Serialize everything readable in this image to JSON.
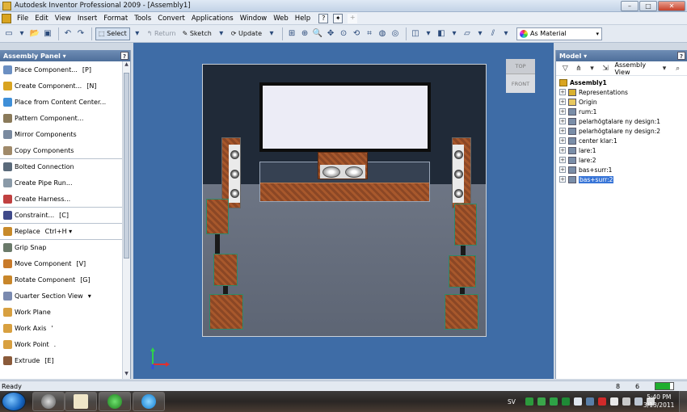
{
  "window": {
    "title": "Autodesk Inventor Professional 2009 - [Assembly1]",
    "minimize": "–",
    "maximize": "□",
    "close": "✕"
  },
  "menu": [
    "File",
    "Edit",
    "View",
    "Insert",
    "Format",
    "Tools",
    "Convert",
    "Applications",
    "Window",
    "Web",
    "Help"
  ],
  "menu_tools": {
    "help_glyph": "?",
    "star_glyph": "✦",
    "plus_glyph": "+"
  },
  "toolbar": {
    "select_label": "Select",
    "return_label": "Return",
    "sketch_label": "Sketch",
    "update_label": "Update",
    "material_label": "As Material",
    "dropdown": "▾"
  },
  "assembly_panel": {
    "title": "Assembly Panel ▾",
    "help": "?",
    "commands": [
      {
        "label": "Place Component...",
        "hotkey": "[P]",
        "color": "#6b8fc2"
      },
      {
        "label": "Create Component...",
        "hotkey": "[N]",
        "color": "#d9a420"
      },
      {
        "label": "Place from Content Center...",
        "hotkey": "",
        "color": "#3f8fd8"
      },
      {
        "label": "Pattern Component...",
        "hotkey": "",
        "color": "#8a7a5a"
      },
      {
        "label": "Mirror Components",
        "hotkey": "",
        "color": "#7a8aa0"
      },
      {
        "label": "Copy Components",
        "hotkey": "",
        "color": "#a08a6a"
      },
      {
        "label": "Bolted Connection",
        "hotkey": "",
        "color": "#5a6a7a",
        "sep": true
      },
      {
        "label": "Create Pipe Run...",
        "hotkey": "",
        "color": "#8a9aa8"
      },
      {
        "label": "Create Harness...",
        "hotkey": "",
        "color": "#c04040"
      },
      {
        "label": "Constraint...",
        "hotkey": "[C]",
        "color": "#404a8a",
        "sep": true
      },
      {
        "label": "Replace",
        "hotkey": "Ctrl+H  ▾",
        "color": "#c88a2a",
        "sep": true
      },
      {
        "label": "Grip Snap",
        "hotkey": "",
        "color": "#6a7a6a",
        "sep": true
      },
      {
        "label": "Move Component",
        "hotkey": "[V]",
        "color": "#c87a2a"
      },
      {
        "label": "Rotate Component",
        "hotkey": "[G]",
        "color": "#c8862a"
      },
      {
        "label": "Quarter Section View",
        "hotkey": "▾",
        "color": "#7a8ab0"
      },
      {
        "label": "Work Plane",
        "hotkey": "",
        "color": "#d8a040"
      },
      {
        "label": "Work Axis",
        "hotkey": "'",
        "color": "#d8a040"
      },
      {
        "label": "Work Point",
        "hotkey": ".",
        "color": "#d8a040"
      },
      {
        "label": "Extrude",
        "hotkey": "[E]",
        "color": "#8a5a3a"
      }
    ]
  },
  "viewcube": {
    "top": "TOP",
    "front": "FRONT"
  },
  "model_panel": {
    "title": "Model ▾",
    "help": "?",
    "view_label": "Assembly View",
    "root": "Assembly1",
    "nodes": [
      {
        "label": "Representations",
        "icon": "#d9b030"
      },
      {
        "label": "Origin",
        "icon": "#e8c860"
      },
      {
        "label": "rum:1",
        "icon": "#7a8ea8"
      },
      {
        "label": "pelarhögtalare ny design:1",
        "icon": "#7a8ea8"
      },
      {
        "label": "pelarhögtalare ny design:2",
        "icon": "#7a8ea8"
      },
      {
        "label": "center klar:1",
        "icon": "#7a8ea8"
      },
      {
        "label": "lare:1",
        "icon": "#7a8ea8"
      },
      {
        "label": "lare:2",
        "icon": "#7a8ea8"
      },
      {
        "label": "bas+surr:1",
        "icon": "#7a8ea8"
      },
      {
        "label": "bas+surr:2",
        "icon": "#7a8ea8",
        "selected": true
      }
    ]
  },
  "status": {
    "text": "Ready",
    "count_a": "8",
    "count_b": "6",
    "memory_fill": 0.8
  },
  "taskbar": {
    "lang": "SV",
    "time": "5:40 PM",
    "date": "3/13/2011"
  }
}
